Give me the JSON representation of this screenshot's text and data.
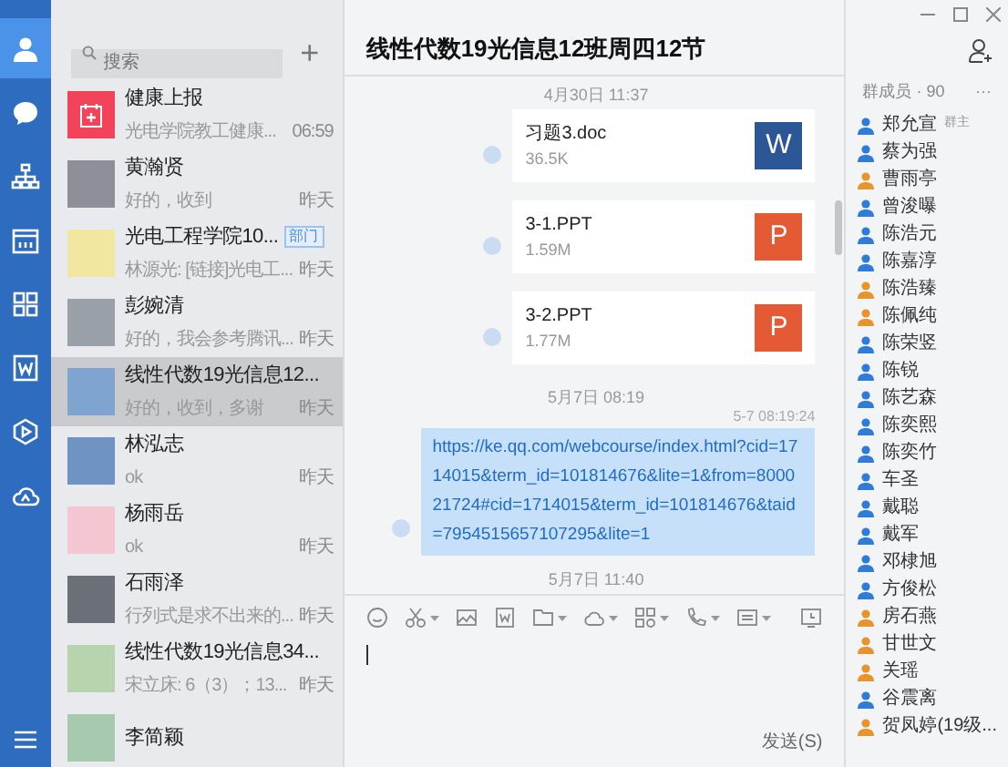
{
  "rail": {
    "items": [
      {
        "kind": "contacts",
        "selected": true
      },
      {
        "kind": "chat",
        "selected": false
      },
      {
        "kind": "org",
        "selected": false
      },
      {
        "kind": "calendar",
        "selected": false
      },
      {
        "kind": "apps",
        "selected": false
      },
      {
        "kind": "doc",
        "selected": false
      },
      {
        "kind": "play",
        "selected": false
      },
      {
        "kind": "cloud",
        "selected": false
      }
    ]
  },
  "chat_list": {
    "search": {
      "placeholder": "搜索"
    },
    "add_button": "+",
    "items": [
      {
        "kind": "app",
        "name": "健康上报",
        "preview": "光电学院教工健康...",
        "time": "06:59",
        "selected": false
      },
      {
        "kind": "photo",
        "name": "黄瀚贤",
        "preview": "好的，收到",
        "time": "昨天",
        "selected": false
      },
      {
        "kind": "photo",
        "name": "光电工程学院10...",
        "tag": "部门",
        "preview": "林源光: [链接]光电工...",
        "time": "昨天",
        "selected": false
      },
      {
        "kind": "photo",
        "name": "彭婉清",
        "preview": "好的，我会参考腾讯...",
        "time": "昨天",
        "selected": false
      },
      {
        "kind": "photo",
        "name": "线性代数19光信息12...",
        "preview": "好的，收到，多谢",
        "time": "昨天",
        "selected": true
      },
      {
        "kind": "photo",
        "name": "林泓志",
        "preview": "ok",
        "time": "昨天",
        "selected": false
      },
      {
        "kind": "photo",
        "name": "杨雨岳",
        "preview": "ok",
        "time": "昨天",
        "selected": false
      },
      {
        "kind": "photo",
        "name": "石雨泽",
        "preview": "行列式是求不出来的...",
        "time": "昨天",
        "selected": false
      },
      {
        "kind": "photo",
        "name": "线性代数19光信息34...",
        "preview": "宋立床: 6（3）；13...",
        "time": "昨天",
        "selected": false
      },
      {
        "kind": "photo",
        "name": "李简颖",
        "selected": false
      }
    ]
  },
  "chat": {
    "title": "线性代数19光信息12班周四12节",
    "messages": [
      {
        "kind": "time",
        "text": "4月30日 11:37"
      },
      {
        "kind": "file",
        "name": "习题3.doc",
        "size": "36.5K",
        "color": "#2b5797",
        "letter": "W"
      },
      {
        "kind": "file",
        "name": "3-1.PPT",
        "size": "1.59M",
        "color": "#e35a34",
        "letter": "P"
      },
      {
        "kind": "file",
        "name": "3-2.PPT",
        "size": "1.77M",
        "color": "#e35a34",
        "letter": "P"
      },
      {
        "kind": "time",
        "text": "5月7日 08:19"
      },
      {
        "kind": "link",
        "timestamp": "5-7 08:19:24",
        "text": "https://ke.qq.com/webcourse/index.html?cid=1714015&term_id=101814676&lite=1&from=800021724#cid=1714015&term_id=101814676&taid=7954515657107295&lite=1"
      },
      {
        "kind": "time",
        "text": "5月7日 11:40"
      }
    ],
    "send_button": "发送(S)"
  },
  "members": {
    "header": "群成员 · 90",
    "more": "···",
    "items": [
      {
        "name": "郑允宣",
        "tag": "群主",
        "color": "#2f7bd9"
      },
      {
        "name": "蔡为强",
        "color": "#2f7bd9"
      },
      {
        "name": "曹雨亭",
        "color": "#e8942e"
      },
      {
        "name": "曾浚曝",
        "color": "#2f7bd9"
      },
      {
        "name": "陈浩元",
        "color": "#2f7bd9"
      },
      {
        "name": "陈嘉淳",
        "color": "#2f7bd9"
      },
      {
        "name": "陈浩臻",
        "color": "#e8942e"
      },
      {
        "name": "陈佩纯",
        "color": "#e8942e"
      },
      {
        "name": "陈荣竖",
        "color": "#2f7bd9"
      },
      {
        "name": "陈锐",
        "color": "#2f7bd9"
      },
      {
        "name": "陈艺森",
        "color": "#2f7bd9"
      },
      {
        "name": "陈奕熙",
        "color": "#2f7bd9"
      },
      {
        "name": "陈奕竹",
        "color": "#2f7bd9"
      },
      {
        "name": "车圣",
        "color": "#2f7bd9"
      },
      {
        "name": "戴聪",
        "color": "#2f7bd9"
      },
      {
        "name": "戴军",
        "color": "#2f7bd9"
      },
      {
        "name": "邓棣旭",
        "color": "#2f7bd9"
      },
      {
        "name": "方俊松",
        "color": "#2f7bd9"
      },
      {
        "name": "房石燕",
        "color": "#e8942e"
      },
      {
        "name": "甘世文",
        "color": "#e8942e"
      },
      {
        "name": "关瑶",
        "color": "#e8942e"
      },
      {
        "name": "谷震离",
        "color": "#2f7bd9"
      },
      {
        "name": "贺凤婷(19级...",
        "color": "#e8942e"
      }
    ]
  }
}
